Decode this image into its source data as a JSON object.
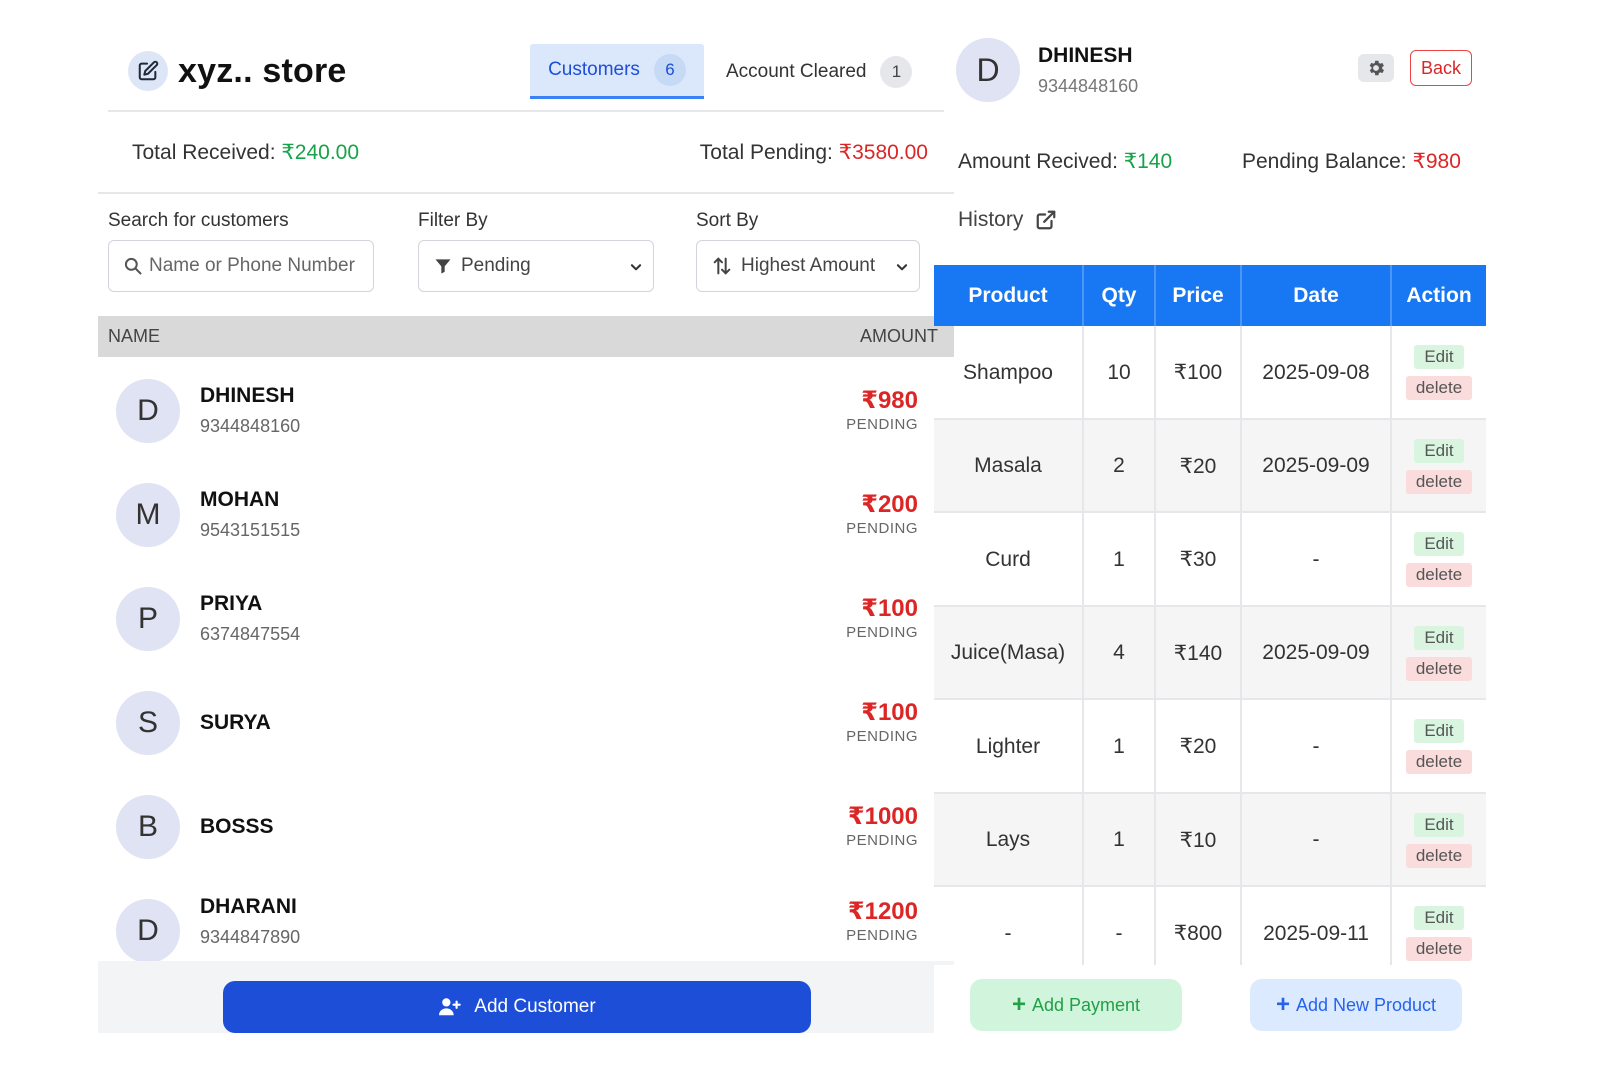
{
  "header": {
    "store_name": "xyz.. store",
    "tabs": [
      {
        "label": "Customers",
        "count": "6"
      },
      {
        "label": "Account Cleared",
        "count": "1"
      }
    ]
  },
  "totals": {
    "received_label": "Total Received: ",
    "received_value": "₹240.00",
    "pending_label": "Total Pending: ",
    "pending_value": "₹3580.00"
  },
  "filters": {
    "search_label": "Search for customers",
    "search_placeholder": "Name or Phone Number",
    "filter_label": "Filter By",
    "filter_value": "Pending",
    "sort_label": "Sort By",
    "sort_value": "Highest Amount"
  },
  "list_header": {
    "name": "NAME",
    "amount": "AMOUNT"
  },
  "customers": [
    {
      "initial": "D",
      "name": "DHINESH",
      "phone": "9344848160",
      "amount": "₹980",
      "status": "PENDING"
    },
    {
      "initial": "M",
      "name": "MOHAN",
      "phone": "9543151515",
      "amount": "₹200",
      "status": "PENDING"
    },
    {
      "initial": "P",
      "name": "PRIYA",
      "phone": "6374847554",
      "amount": "₹100",
      "status": "PENDING"
    },
    {
      "initial": "S",
      "name": "SURYA",
      "phone": "",
      "amount": "₹100",
      "status": "PENDING"
    },
    {
      "initial": "B",
      "name": "BOSSS",
      "phone": "",
      "amount": "₹1000",
      "status": "PENDING"
    },
    {
      "initial": "D",
      "name": "DHARANI",
      "phone": "9344847890",
      "amount": "₹1200",
      "status": "PENDING"
    }
  ],
  "add_customer_label": "Add Customer",
  "detail": {
    "initial": "D",
    "name": "DHINESH",
    "phone": "9344848160",
    "back_label": "Back",
    "received_label": "Amount Recived: ",
    "received_value": "₹140",
    "pending_label": "Pending Balance: ",
    "pending_value": "₹980",
    "history_label": "History"
  },
  "table": {
    "headers": [
      "Product",
      "Qty",
      "Price",
      "Date",
      "Action"
    ],
    "rows": [
      {
        "product": "Shampoo",
        "qty": "10",
        "price": "₹100",
        "date": "2025-09-08"
      },
      {
        "product": "Masala",
        "qty": "2",
        "price": "₹20",
        "date": "2025-09-09"
      },
      {
        "product": "Curd",
        "qty": "1",
        "price": "₹30",
        "date": "-"
      },
      {
        "product": "Juice(Masa)",
        "qty": "4",
        "price": "₹140",
        "date": "2025-09-09"
      },
      {
        "product": "Lighter",
        "qty": "1",
        "price": "₹20",
        "date": "-"
      },
      {
        "product": "Lays",
        "qty": "1",
        "price": "₹10",
        "date": "-"
      },
      {
        "product": "-",
        "qty": "-",
        "price": "₹800",
        "date": "2025-09-11"
      }
    ],
    "edit_label": "Edit",
    "delete_label": "delete"
  },
  "footer": {
    "add_payment_label": "Add Payment",
    "add_product_label": "Add New Product"
  },
  "colors": {
    "primary": "#1d4ed8",
    "table_header": "#1877f2",
    "received": "#16a34a",
    "pending": "#dc2626"
  }
}
